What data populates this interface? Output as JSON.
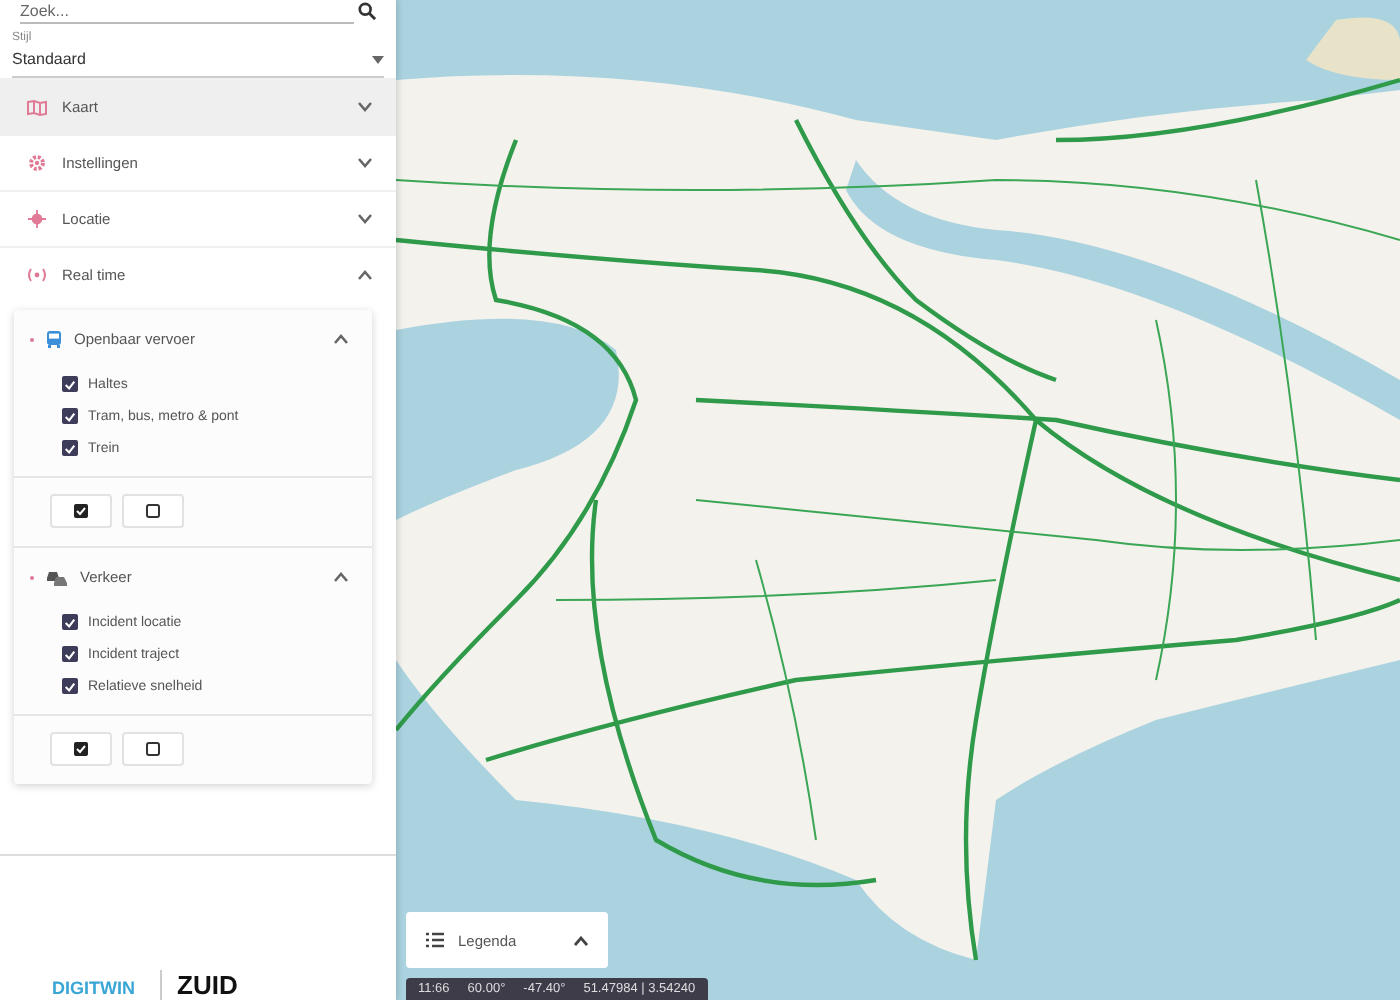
{
  "search": {
    "placeholder": "Zoek..."
  },
  "style_select": {
    "label": "Stijl",
    "value": "Standaard"
  },
  "sections": [
    {
      "kind": "map",
      "label": "Kaart",
      "expanded": false,
      "selected": true
    },
    {
      "kind": "settings",
      "label": "Instellingen",
      "expanded": false,
      "selected": false
    },
    {
      "kind": "location",
      "label": "Locatie",
      "expanded": false,
      "selected": false
    },
    {
      "kind": "realtime",
      "label": "Real time",
      "expanded": true,
      "selected": false
    }
  ],
  "realtime_groups": [
    {
      "kind": "bus",
      "title": "Openbaar vervoer",
      "expanded": true,
      "items": [
        {
          "label": "Haltes",
          "checked": true
        },
        {
          "label": "Tram, bus, metro & pont",
          "checked": true
        },
        {
          "label": "Trein",
          "checked": true
        }
      ]
    },
    {
      "kind": "car",
      "title": "Verkeer",
      "expanded": true,
      "items": [
        {
          "label": "Incident locatie",
          "checked": true
        },
        {
          "label": "Incident traject",
          "checked": true
        },
        {
          "label": "Relatieve snelheid",
          "checked": true
        }
      ]
    }
  ],
  "logos": [
    "DIGITWIN",
    "ZUID"
  ],
  "legend": {
    "label": "Legenda"
  },
  "status_bar": [
    "11:66",
    "60.00°",
    "-47.40°",
    "51.47984 | 3.54240"
  ]
}
